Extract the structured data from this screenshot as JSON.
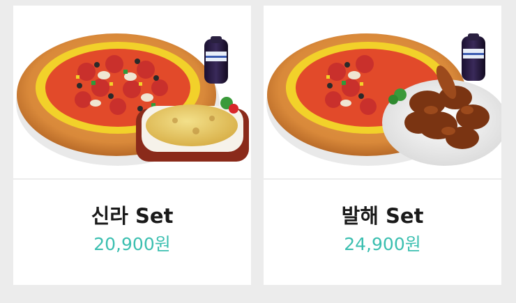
{
  "menu": {
    "items": [
      {
        "name": "신라 Set",
        "price": "20,900원",
        "image_icon": "pizza-gratin-cola-image",
        "side": "gratin"
      },
      {
        "name": "발해 Set",
        "price": "24,900원",
        "image_icon": "pizza-chicken-cola-image",
        "side": "chicken"
      }
    ]
  },
  "colors": {
    "background": "#ececec",
    "card": "#ffffff",
    "title": "#1a1a1a",
    "price": "#3bbfb0"
  }
}
